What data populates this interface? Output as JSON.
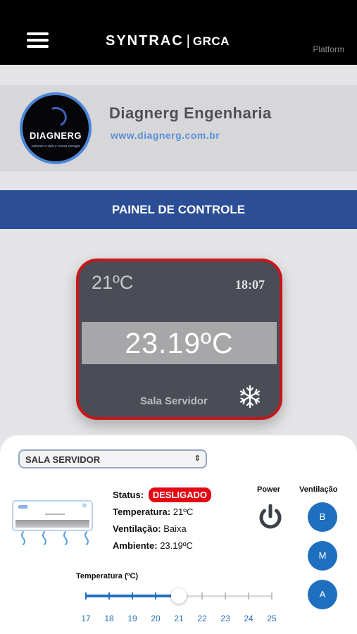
{
  "header": {
    "brand": "SYNTRAC",
    "separator": "|",
    "brand_sub": "GRCA",
    "platform": "Platform"
  },
  "company": {
    "logo_text": "DIAGNERG",
    "logo_tagline": "valorize a vida e nossa energia",
    "name": "Diagnerg Engenharia",
    "website": "www.diagnerg.com.br"
  },
  "panel": {
    "title": "PAINEL DE CONTROLE"
  },
  "thermostat": {
    "setpoint": "21ºC",
    "time": "18:07",
    "current_temp": "23.19ºC",
    "room": "Sala Servidor",
    "mode_icon": "snowflake-icon",
    "border_color": "#c8161c"
  },
  "controls": {
    "room_select": {
      "value": "SALA SERVIDOR"
    },
    "status": {
      "label": "Status:",
      "value": "DESLIGADO",
      "color": "#e30613"
    },
    "temperature": {
      "label": "Temperatura:",
      "value": "21ºC"
    },
    "ventilation": {
      "label": "Ventilação:",
      "value": "Baixa"
    },
    "ambient": {
      "label": "Ambiente:",
      "value": "23.19ºC"
    },
    "power_label": "Power",
    "power_icon": "power-icon",
    "vent_label": "Ventilação",
    "vent_buttons": [
      "B",
      "M",
      "A"
    ],
    "accent": "#1f6fc0"
  },
  "temp_slider": {
    "label": "Temperatura (ºC)",
    "ticks": [
      "17",
      "18",
      "19",
      "20",
      "21",
      "22",
      "23",
      "24",
      "25"
    ],
    "min": 17,
    "max": 25,
    "value": 21
  }
}
